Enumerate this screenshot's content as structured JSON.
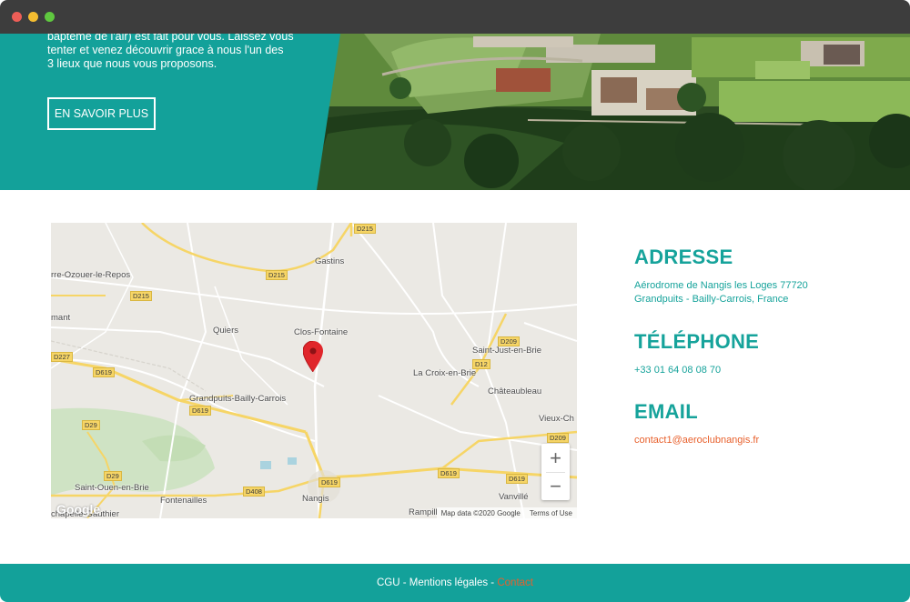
{
  "colors": {
    "teal": "#16a39b",
    "footer_teal": "#13a19a",
    "accent_orange": "#e8602c",
    "titlebar": "#3d3d3d"
  },
  "titlebar": {
    "buttons": [
      {
        "name": "close",
        "color": "#ee5e57"
      },
      {
        "name": "minimize",
        "color": "#f5bd30"
      },
      {
        "name": "maximize",
        "color": "#5fc83f"
      }
    ]
  },
  "hero": {
    "text_lines": [
      "baptême de l'air) est fait pour vous. Laissez vous",
      "tenter et venez découvrir grace à nous l'un des",
      "3 lieux que nous vous proposons."
    ],
    "button_label": "EN SAVOIR PLUS"
  },
  "map": {
    "places": [
      {
        "id": "gastins",
        "label": "Gastins"
      },
      {
        "id": "ozouer",
        "label": "rre-Ozouer-le-Repos"
      },
      {
        "id": "quiers",
        "label": "Quiers"
      },
      {
        "id": "clos-fontaine",
        "label": "Clos-Fontaine"
      },
      {
        "id": "saint-just",
        "label": "Saint-Just-en-Brie"
      },
      {
        "id": "croix-en-brie",
        "label": "La Croix-en-Brie"
      },
      {
        "id": "chateaubleau",
        "label": "Châteaubleau"
      },
      {
        "id": "grandpuits",
        "label": "Grandpuits-Bailly-Carrois"
      },
      {
        "id": "vieux-ch",
        "label": "Vieux-Ch"
      },
      {
        "id": "mant",
        "label": "mant"
      },
      {
        "id": "saint-ouen",
        "label": "Saint-Ouen-en-Brie"
      },
      {
        "id": "fontenailles",
        "label": "Fontenailles"
      },
      {
        "id": "nangis",
        "label": "Nangis"
      },
      {
        "id": "vanville",
        "label": "Vanvillé"
      },
      {
        "id": "rampill",
        "label": "Rampill"
      },
      {
        "id": "chapelle",
        "label": "chapelle-Gauthier"
      }
    ],
    "road_badges": [
      "D215",
      "D215",
      "D215",
      "D209",
      "D12",
      "D227",
      "D619",
      "D619",
      "D29",
      "D209",
      "D29",
      "D619",
      "D619",
      "D619",
      "D408"
    ],
    "zoom_in": "+",
    "zoom_out": "−",
    "google_logo": "Google",
    "attribution": "Map data ©2020 Google",
    "terms": "Terms of Use"
  },
  "info": {
    "address_title": "ADRESSE",
    "address_line1": "Aérodrome de Nangis les Loges 77720",
    "address_line2": "Grandpuits - Bailly-Carrois, France",
    "phone_title": "TÉLÉPHONE",
    "phone": "+33 01 64 08 08 70",
    "email_title": "EMAIL",
    "email": "contact1@aeroclubnangis.fr"
  },
  "footer": {
    "cgu": "CGU",
    "sep1": " - ",
    "mentions": "Mentions légales",
    "sep2": " - ",
    "contact": "Contact"
  }
}
